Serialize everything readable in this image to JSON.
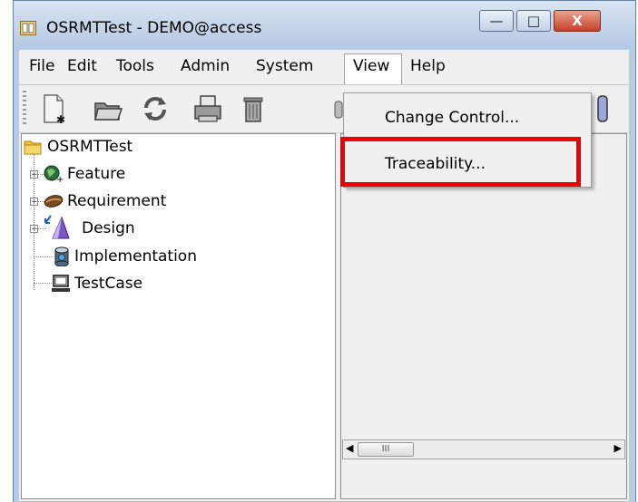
{
  "window": {
    "title": "OSRMTTest - DEMO@access",
    "controls": {
      "minimize_glyph": "—",
      "maximize_glyph": "□",
      "close_glyph": "X"
    }
  },
  "menubar": {
    "items": [
      "File",
      "Edit",
      "Tools",
      "Admin",
      "System",
      "View",
      "Help"
    ],
    "active": "View"
  },
  "toolbar": {
    "icons": [
      "new-document-icon",
      "open-folder-icon",
      "refresh-icon",
      "print-icon",
      "delete-icon"
    ]
  },
  "tree": {
    "root": "OSRMTTest",
    "children": [
      {
        "label": "Feature",
        "icon": "feature-globe-icon",
        "expandable": true
      },
      {
        "label": "Requirement",
        "icon": "requirement-bean-icon",
        "expandable": true
      },
      {
        "label": "Design",
        "icon": "design-triangle-icon",
        "expandable": true
      },
      {
        "label": "Implementation",
        "icon": "implementation-cylinder-icon",
        "expandable": false
      },
      {
        "label": "TestCase",
        "icon": "testcase-computer-icon",
        "expandable": false
      }
    ]
  },
  "view_menu": {
    "items": [
      "Change Control...",
      "Traceability..."
    ],
    "highlighted": "Traceability..."
  },
  "scrollbar": {
    "thumb_grip": "III"
  },
  "colors": {
    "highlight_border": "#ee0000",
    "status_bar": "#ffffde",
    "titlebar": "#c5d6ec"
  }
}
